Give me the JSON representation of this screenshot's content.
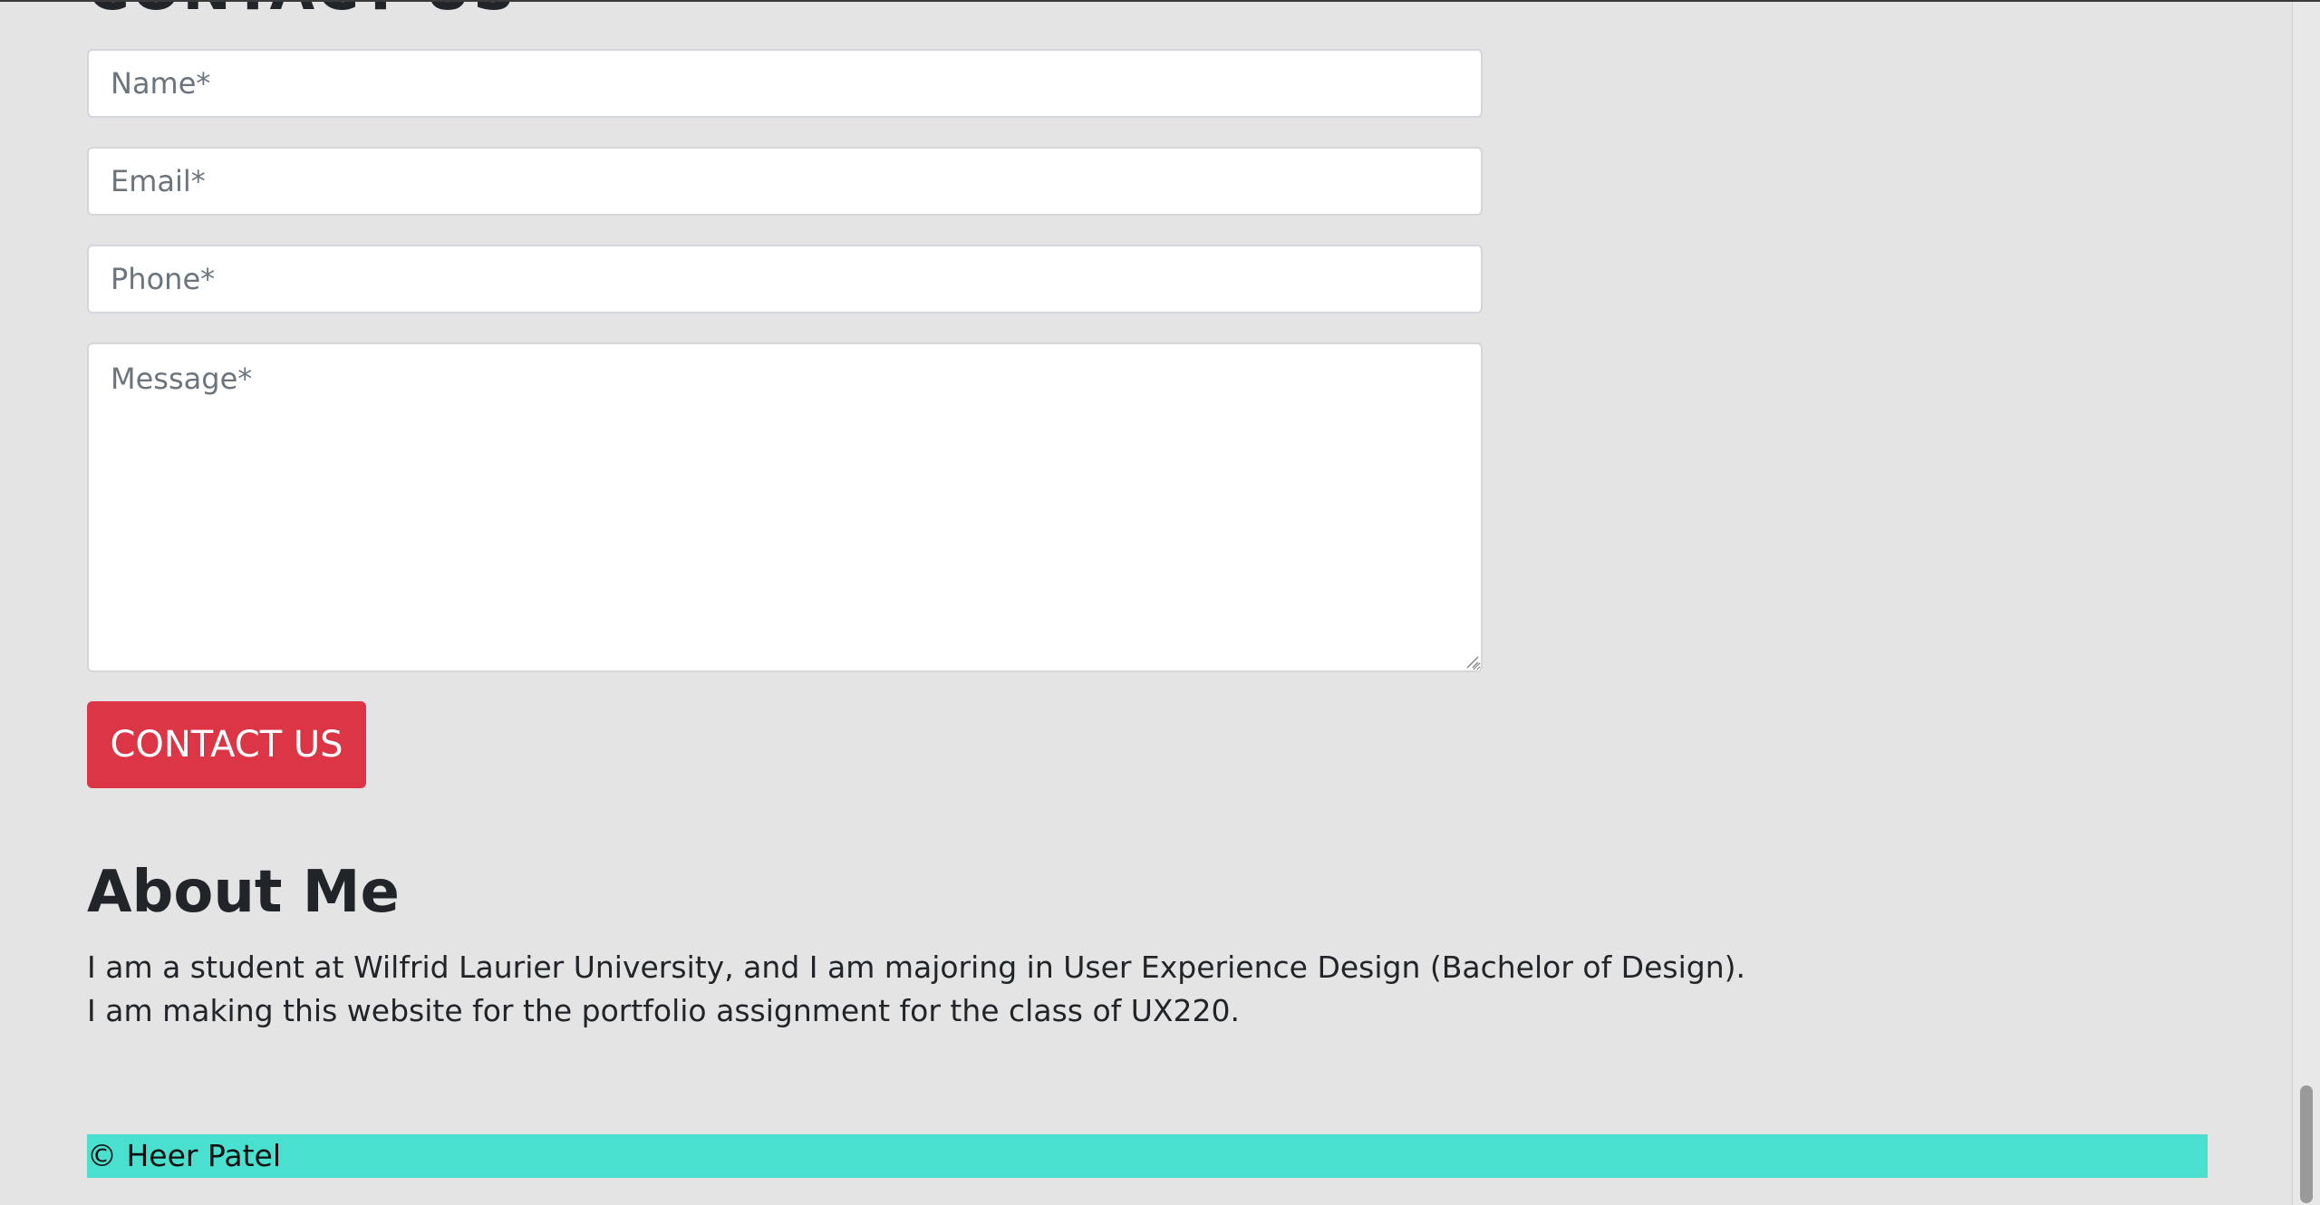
{
  "contact": {
    "heading": "CONTACT US",
    "name_placeholder": "Name*",
    "email_placeholder": "Email*",
    "phone_placeholder": "Phone*",
    "message_placeholder": "Message*",
    "submit_label": "CONTACT US",
    "button_color": "#dc3545"
  },
  "about": {
    "heading": "About Me",
    "line1": "I am a student at Wilfrid Laurier University, and I am majoring in User Experience Design (Bachelor of Design).",
    "line2": "I am making this website for the portfolio assignment for the class of UX220."
  },
  "footer": {
    "text": "© Heer Patel",
    "color": "#4ae0d0"
  }
}
